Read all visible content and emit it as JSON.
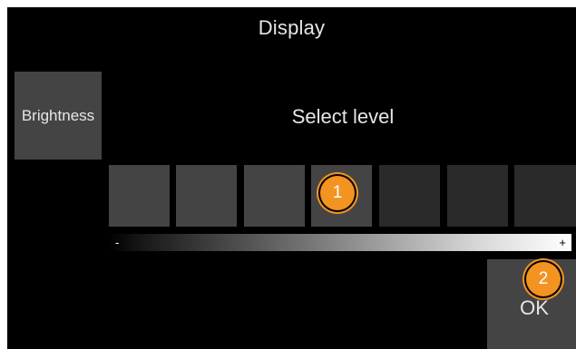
{
  "screen": {
    "title": "Display",
    "side_tab_label": "Brightness",
    "prompt": "Select level"
  },
  "brightness": {
    "total_levels": 7,
    "selected_level": 4,
    "scale_min_label": "-",
    "scale_max_label": "+"
  },
  "ok_button": {
    "label": "OK"
  },
  "markers": [
    {
      "label": "1"
    },
    {
      "label": "2"
    }
  ],
  "colors": {
    "background": "#000000",
    "tile_active": "#444444",
    "tile_inactive": "#2a2a2a",
    "marker": "#f39322",
    "text": "#e6e6e6"
  }
}
